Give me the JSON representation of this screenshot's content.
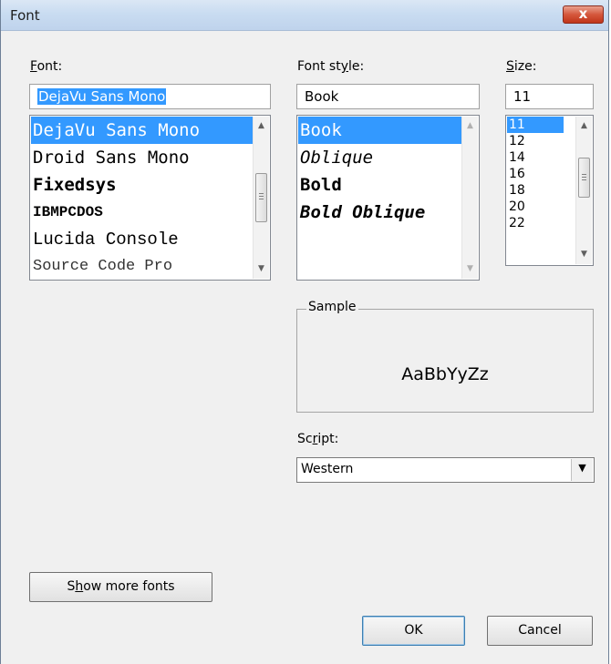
{
  "window": {
    "title": "Font",
    "close_label": "x"
  },
  "font": {
    "label_u": "F",
    "label_rest": "ont:",
    "value": "DejaVu Sans Mono",
    "items": [
      {
        "label": "DejaVu Sans Mono",
        "selected": true
      },
      {
        "label": "Droid Sans Mono",
        "selected": false
      },
      {
        "label": "Fixedsys",
        "selected": false
      },
      {
        "label": "IBMPCDOS",
        "selected": false
      },
      {
        "label": "Lucida Console",
        "selected": false
      },
      {
        "label": "Source Code Pro",
        "selected": false
      }
    ]
  },
  "style": {
    "label_pre": "Font st",
    "label_u": "y",
    "label_rest": "le:",
    "value": "Book",
    "items": [
      {
        "label": "Book",
        "selected": true
      },
      {
        "label": "Oblique",
        "selected": false
      },
      {
        "label": "Bold",
        "selected": false
      },
      {
        "label": "Bold Oblique",
        "selected": false
      }
    ]
  },
  "size": {
    "label_u": "S",
    "label_rest": "ize:",
    "value": "11",
    "items": [
      {
        "label": "11",
        "selected": true
      },
      {
        "label": "12",
        "selected": false
      },
      {
        "label": "14",
        "selected": false
      },
      {
        "label": "16",
        "selected": false
      },
      {
        "label": "18",
        "selected": false
      },
      {
        "label": "20",
        "selected": false
      },
      {
        "label": "22",
        "selected": false
      }
    ]
  },
  "sample": {
    "label": "Sample",
    "text": "AaBbYyZz"
  },
  "script": {
    "label_pre": "Sc",
    "label_u": "r",
    "label_rest": "ipt:",
    "value": "Western"
  },
  "buttons": {
    "more_fonts_pre": "S",
    "more_fonts_u": "h",
    "more_fonts_rest": "ow more fonts",
    "ok": "OK",
    "cancel": "Cancel"
  },
  "icons": {
    "up_arrow": "▲",
    "down_arrow": "▼",
    "combo_arrow": "▼"
  }
}
